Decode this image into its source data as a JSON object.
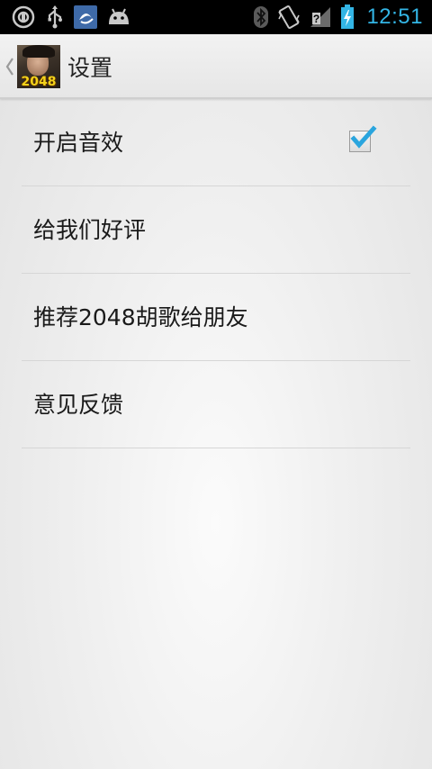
{
  "status_bar": {
    "time": "12:51",
    "left_icons": [
      "call-recording-icon",
      "usb-icon",
      "app-notification-icon",
      "android-debug-icon"
    ],
    "right_icons": [
      "bluetooth-icon",
      "vibrate-icon",
      "signal-icon",
      "battery-charging-icon"
    ],
    "accent_color": "#33b5e5"
  },
  "action_bar": {
    "title": "设置",
    "logo_text": "2048"
  },
  "settings": {
    "items": [
      {
        "label": "开启音效",
        "checked": true
      },
      {
        "label": "给我们好评"
      },
      {
        "label": "推荐2048胡歌给朋友"
      },
      {
        "label": "意见反馈"
      }
    ]
  }
}
